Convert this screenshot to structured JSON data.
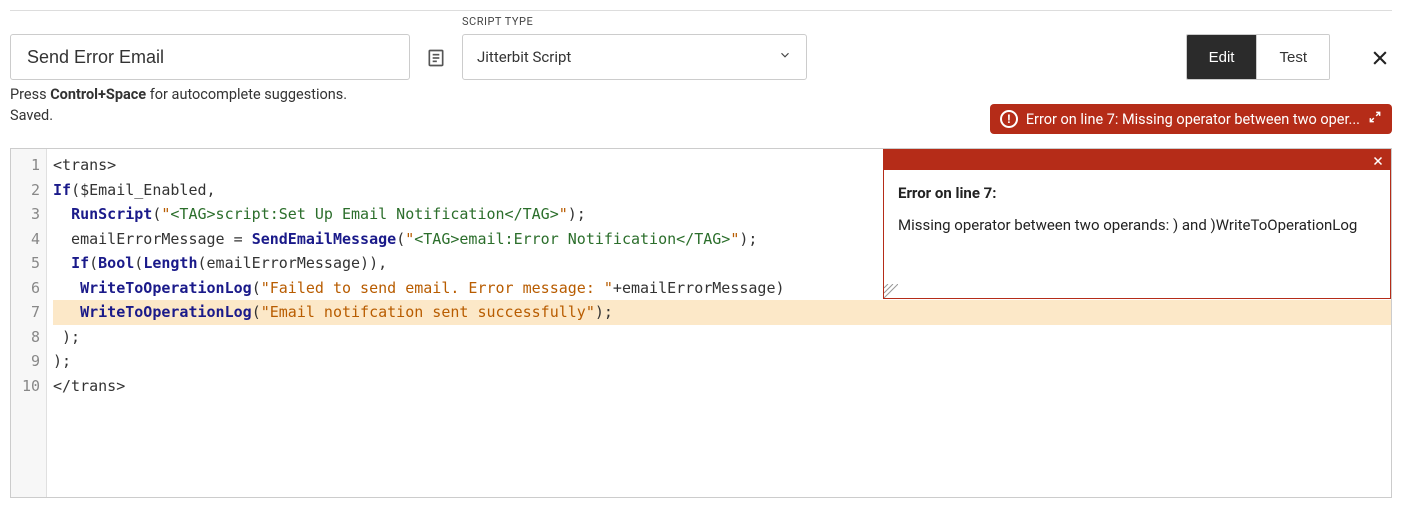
{
  "header": {
    "script_name": "Send Error Email",
    "script_type_label": "SCRIPT TYPE",
    "script_type_value": "Jitterbit Script",
    "edit_label": "Edit",
    "test_label": "Test"
  },
  "help": {
    "press": "Press ",
    "shortcut": "Control+Space",
    "rest": " for autocomplete suggestions."
  },
  "status": {
    "saved": "Saved."
  },
  "error_bar": {
    "text": "Error on line 7: Missing operator between two oper..."
  },
  "error_panel": {
    "title": "Error on line 7:",
    "body": "Missing operator between two operands: ) and )WriteToOperationLog"
  },
  "code": {
    "line1": "<trans>",
    "line2_kw": "If",
    "line2_rest": "($Email_Enabled,",
    "line3_fn": "RunScript",
    "line3_open": "(",
    "line3_str_q1": "\"",
    "line3_tag": "<TAG>script:Set Up Email Notification</TAG>",
    "line3_str_q2": "\"",
    "line3_close": ");",
    "line4_lhs": "  emailErrorMessage = ",
    "line4_fn": "SendEmailMessage",
    "line4_open": "(",
    "line4_str_q1": "\"",
    "line4_tag": "<TAG>email:Error Notification</TAG>",
    "line4_str_q2": "\"",
    "line4_close": ");",
    "line5_if": "If",
    "line5_open": "(",
    "line5_bool": "Bool",
    "line5_open2": "(",
    "line5_len": "Length",
    "line5_rest": "(emailErrorMessage)),",
    "line6_fn": "WriteToOperationLog",
    "line6_open": "(",
    "line6_str": "\"Failed to send email. Error message: \"",
    "line6_rest": "+emailErrorMessage)",
    "line7_fn": "WriteToOperationLog",
    "line7_open": "(",
    "line7_str": "\"Email notifcation sent successfully\"",
    "line7_close": ");",
    "line8": " );",
    "line9": ");",
    "line10": "</trans>"
  }
}
